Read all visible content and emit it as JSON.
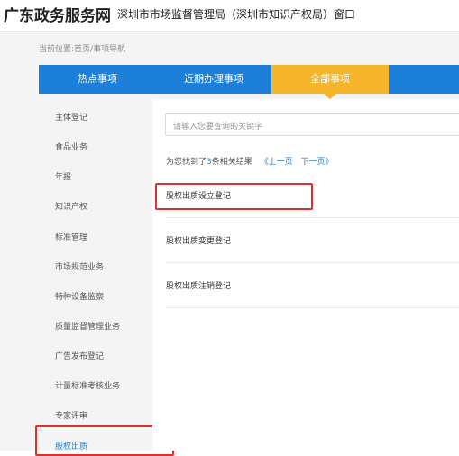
{
  "header": {
    "site_name": "广东政务服务网",
    "org_title": "深圳市市场监督管理局（深圳市知识产权局）窗口"
  },
  "breadcrumb": "当前位置:首页/事项导航",
  "tabs": [
    {
      "label": "热点事项",
      "active": false
    },
    {
      "label": "近期办理事项",
      "active": false
    },
    {
      "label": "全部事项",
      "active": true
    }
  ],
  "colors": {
    "tab_bg": "#1c7fd9",
    "tab_active": "#f7b52b",
    "highlight_border": "#d9312b",
    "link": "#1c7fd9"
  },
  "sidebar": {
    "items": [
      {
        "label": "主体登记"
      },
      {
        "label": "食品业务"
      },
      {
        "label": "年报"
      },
      {
        "label": "知识产权"
      },
      {
        "label": "标准管理"
      },
      {
        "label": "市场规范业务"
      },
      {
        "label": "特种设备监察"
      },
      {
        "label": "质量监督管理业务"
      },
      {
        "label": "广告发布登记"
      },
      {
        "label": "计量标准考核业务"
      },
      {
        "label": "专家评审"
      },
      {
        "label": "股权出质",
        "selected": true
      }
    ]
  },
  "search": {
    "placeholder": "请输入您要查询的关键字"
  },
  "results": {
    "prefix": "为您找到了",
    "count": "3",
    "suffix": "条相关结果",
    "prev_page": "《上一页",
    "next_page": "下一页》",
    "items": [
      {
        "label": "股权出质设立登记",
        "highlighted": true
      },
      {
        "label": "股权出质变更登记"
      },
      {
        "label": "股权出质注销登记"
      }
    ]
  }
}
